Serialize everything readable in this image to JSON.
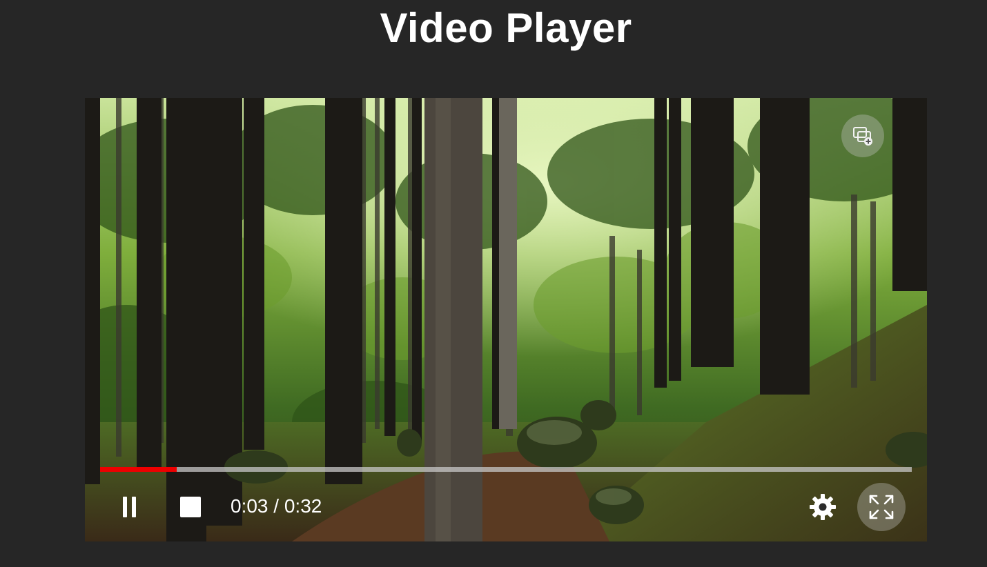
{
  "page": {
    "title": "Video Player"
  },
  "player": {
    "current_time": "0:03",
    "separator": " / ",
    "duration": "0:32",
    "progress_fraction": 0.094,
    "colors": {
      "progress_fill": "#ee0000",
      "progress_track": "#c8c8c8",
      "background": "#262626"
    },
    "controls": {
      "pause_icon": "pause-icon",
      "stop_icon": "stop-icon",
      "settings_icon": "gear-icon",
      "fullscreen_icon": "fullscreen-icon",
      "pip_icon": "picture-in-picture-icon"
    }
  }
}
